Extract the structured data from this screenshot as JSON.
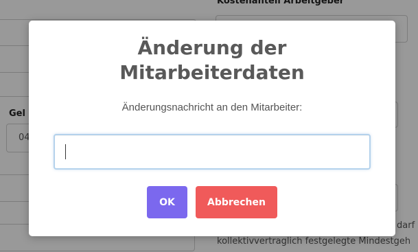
{
  "background": {
    "section_title": "Kostenanteil Arbeitgeber",
    "field_label": "Gel",
    "field_value": "04",
    "hint_text_1": "darf",
    "hint_text_2": "kollektivvertraglich festgelegte Mindestgeh"
  },
  "modal": {
    "title_line1": "Änderung der",
    "title_line2": "Mitarbeiterdaten",
    "message": "Änderungsnachricht an den Mitarbeiter:",
    "input_value": "",
    "ok_label": "OK",
    "cancel_label": "Abbrechen",
    "colors": {
      "ok_button": "#7b68ee",
      "cancel_button": "#f05a5a",
      "overlay": "rgba(0,0,0,0.4)"
    }
  }
}
